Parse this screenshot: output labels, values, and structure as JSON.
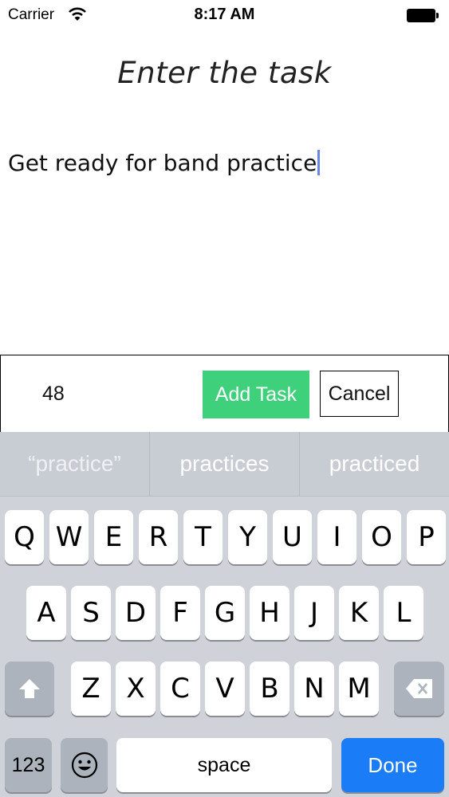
{
  "status": {
    "carrier": "Carrier",
    "time": "8:17 AM"
  },
  "page": {
    "title": "Enter the task",
    "task_text": "Get ready for band practice"
  },
  "actions": {
    "char_count": "48",
    "add_label": "Add Task",
    "cancel_label": "Cancel",
    "accent": "#3fd07c"
  },
  "keyboard": {
    "suggestions": [
      "“practice”",
      "practices",
      "practiced"
    ],
    "row1": [
      "Q",
      "W",
      "E",
      "R",
      "T",
      "Y",
      "U",
      "I",
      "O",
      "P"
    ],
    "row2": [
      "A",
      "S",
      "D",
      "F",
      "G",
      "H",
      "J",
      "K",
      "L"
    ],
    "row3": [
      "Z",
      "X",
      "C",
      "V",
      "B",
      "N",
      "M"
    ],
    "numbers_label": "123",
    "space_label": "space",
    "done_label": "Done",
    "done_color": "#1a7cf7"
  }
}
